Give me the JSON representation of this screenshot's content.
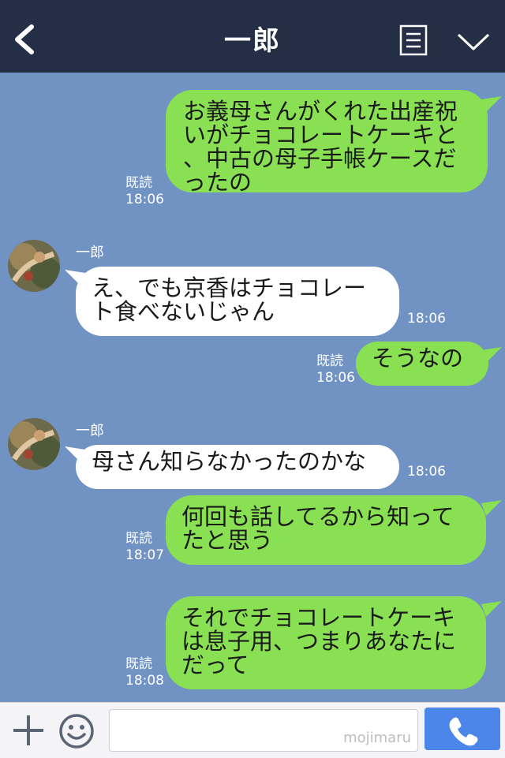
{
  "header": {
    "title": "一郎"
  },
  "messages": [
    {
      "dir": "out",
      "text": "お義母さんがくれた出産祝\nいがチョコレートケーキと\n、中古の母子手帳ケースだ\nったの",
      "read": "既読",
      "time": "18:06"
    },
    {
      "dir": "in",
      "sender": "一郎",
      "text": "え、でも京香はチョコレー\nト食べないじゃん",
      "time": "18:06"
    },
    {
      "dir": "out",
      "text": "そうなの",
      "read": "既読",
      "time": "18:06"
    },
    {
      "dir": "in",
      "sender": "一郎",
      "text": "母さん知らなかったのかな",
      "time": "18:06"
    },
    {
      "dir": "out",
      "text": "何回も話してるから知って\nたと思う",
      "read": "既読",
      "time": "18:07"
    },
    {
      "dir": "out",
      "text": "それでチョコレートケーキ\nは息子用、つまりあなたに\nだって",
      "read": "既読",
      "time": "18:08"
    }
  ],
  "footer": {
    "watermark": "mojimaru"
  },
  "colors": {
    "header": "#242e45",
    "background": "#7193c3",
    "outgoing": "#88e052",
    "incoming": "#ffffff",
    "send": "#4b86e8"
  },
  "icons": {
    "back": "back-chevron-icon",
    "menu": "list-menu-icon",
    "collapse": "chevron-down-icon",
    "add": "plus-icon",
    "emoji": "smiley-icon",
    "call": "phone-icon"
  }
}
